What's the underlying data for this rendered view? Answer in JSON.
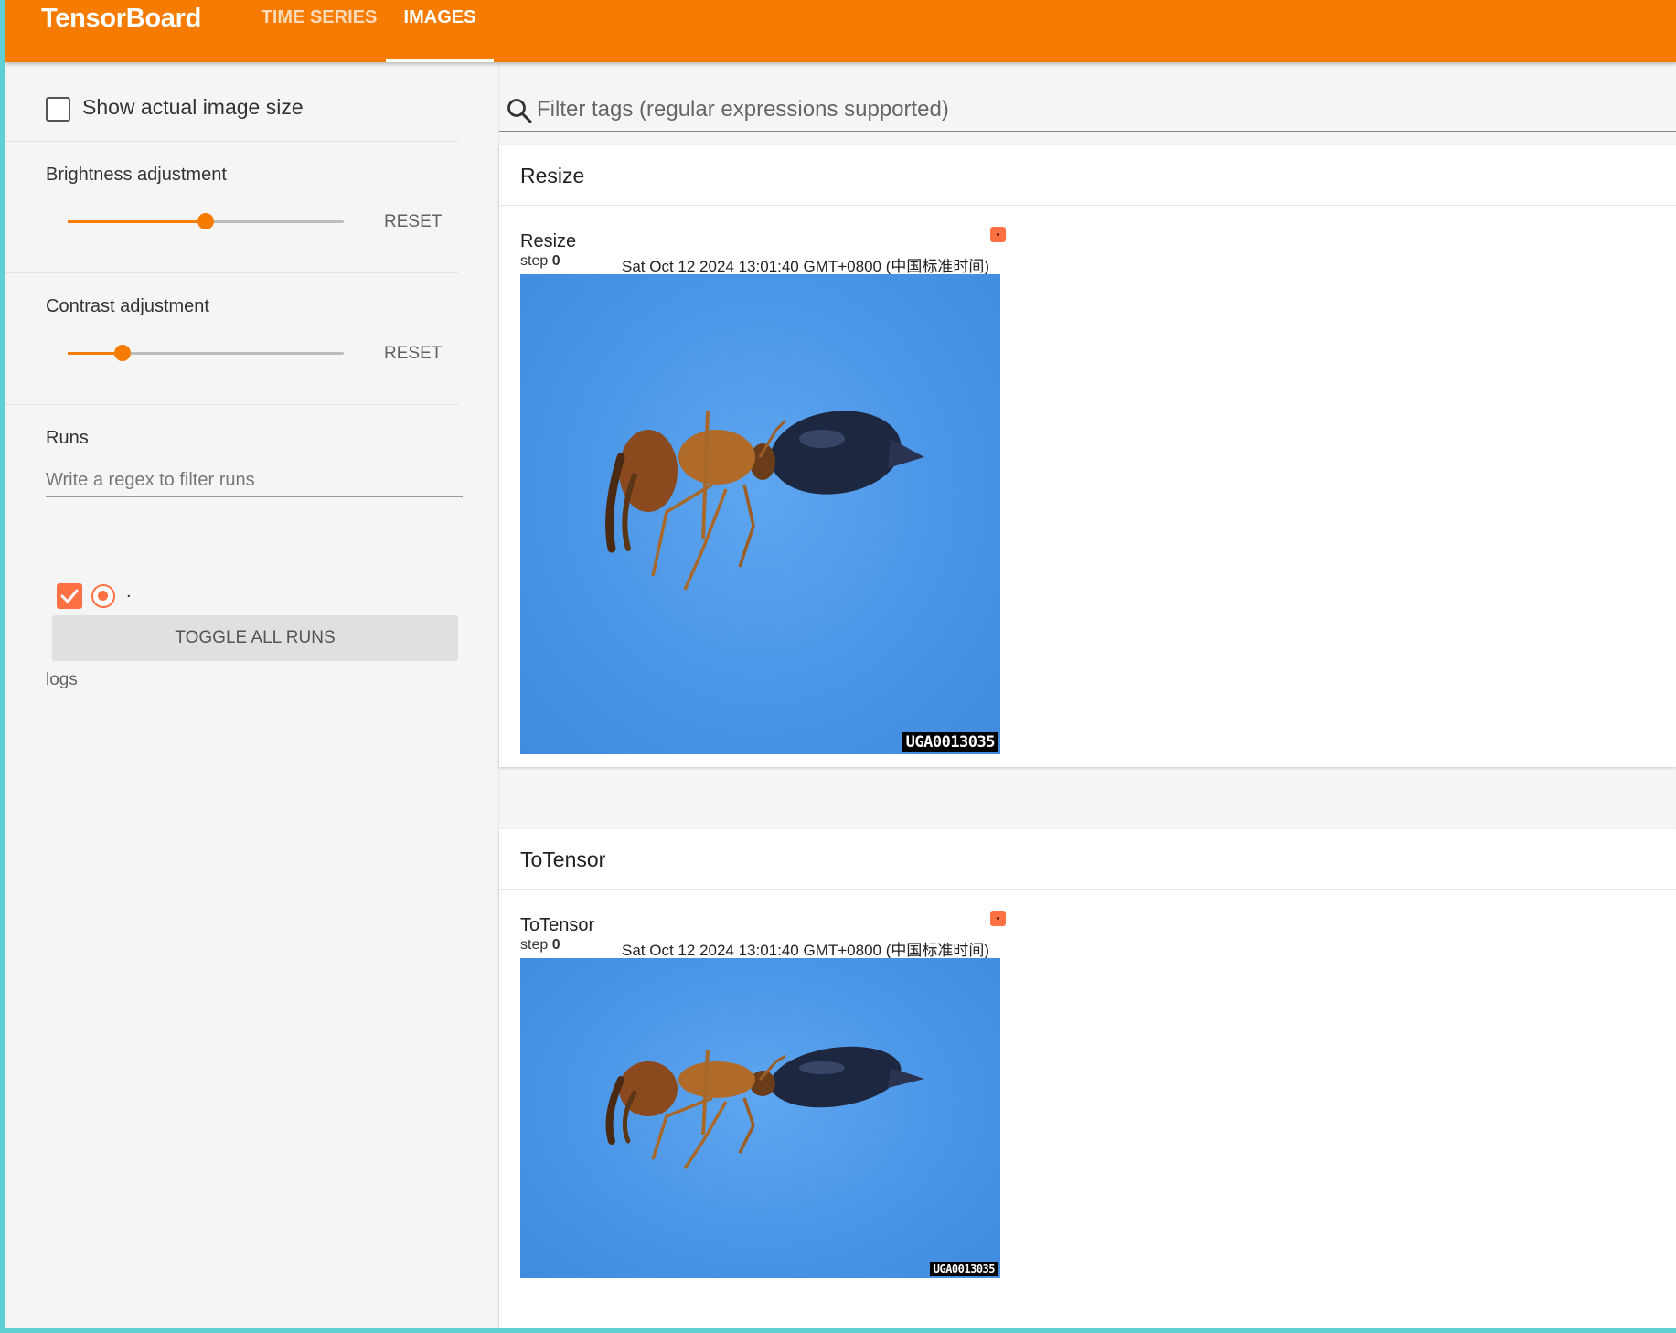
{
  "header": {
    "brand": "TensorBoard",
    "tabs": [
      {
        "label": "TIME SERIES",
        "active": false
      },
      {
        "label": "IMAGES",
        "active": true
      }
    ],
    "accent_color": "#f57c00"
  },
  "sidebar": {
    "show_actual_size_label": "Show actual image size",
    "show_actual_size_checked": false,
    "brightness": {
      "label": "Brightness adjustment",
      "reset_label": "RESET",
      "value_fraction": 0.5
    },
    "contrast": {
      "label": "Contrast adjustment",
      "reset_label": "RESET",
      "value_fraction": 0.2
    },
    "runs": {
      "title": "Runs",
      "filter_placeholder": "Write a regex to filter runs",
      "items": [
        {
          "name": ".",
          "checked": true,
          "color": "#ff7043"
        }
      ],
      "toggle_all_label": "TOGGLE ALL RUNS",
      "logdir": "logs"
    }
  },
  "main": {
    "filter_placeholder": "Filter tags (regular expressions supported)",
    "cards": [
      {
        "header": "Resize",
        "image_title": "Resize",
        "step_label": "step",
        "step_value": "0",
        "timestamp": "Sat Oct 12 2024 13:01:40 GMT+0800 (中国标准时间)",
        "watermark": "UGA0013035"
      },
      {
        "header": "ToTensor",
        "image_title": "ToTensor",
        "step_label": "step",
        "step_value": "0",
        "timestamp": "Sat Oct 12 2024 13:01:40 GMT+0800 (中国标准时间)",
        "watermark": "UGA0013035"
      }
    ]
  }
}
